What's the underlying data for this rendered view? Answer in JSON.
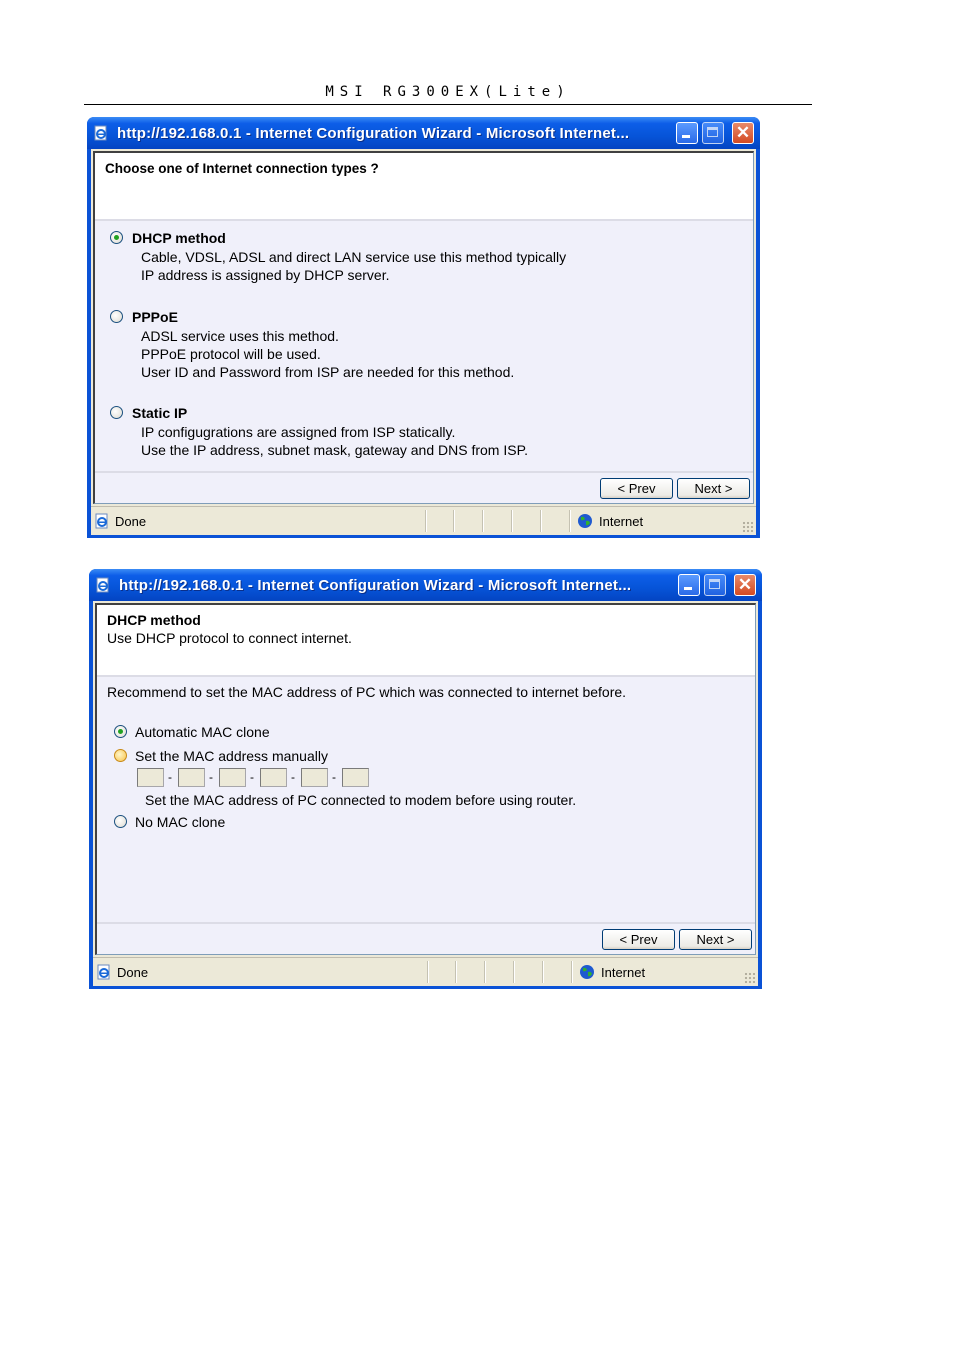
{
  "document": {
    "header": "MSI RG300EX(Lite)"
  },
  "window1": {
    "title": "http://192.168.0.1 - Internet Configuration Wizard - Microsoft Internet...",
    "heading": "Choose one of Internet connection types ?",
    "options": [
      {
        "label": "DHCP method",
        "checked": true,
        "lines": [
          "Cable, VDSL, ADSL and direct LAN service use this method typically",
          "IP address is assigned by DHCP server."
        ]
      },
      {
        "label": "PPPoE",
        "checked": false,
        "lines": [
          "ADSL service uses this method.",
          "PPPoE protocol will be used.",
          "User ID and Password from ISP are needed for this method."
        ]
      },
      {
        "label": "Static IP",
        "checked": false,
        "lines": [
          "IP configugrations are assigned from ISP statically.",
          "Use the IP address, subnet mask, gateway and DNS from ISP."
        ]
      }
    ],
    "prev_label": "< Prev",
    "next_label": "Next >",
    "status_text": "Done",
    "zone_text": "Internet"
  },
  "window2": {
    "title": "http://192.168.0.1 - Internet Configuration Wizard - Microsoft Internet...",
    "heading": "DHCP method",
    "subheading": "Use DHCP protocol to connect internet.",
    "recommend": "Recommend to set the MAC address of PC which was connected to internet before.",
    "options": [
      {
        "label": "Automatic MAC clone",
        "checked": true
      },
      {
        "label": "Set the MAC address manually",
        "checked": false,
        "hover": true
      },
      {
        "label": "No MAC clone",
        "checked": false
      }
    ],
    "mac_fields": [
      "",
      "",
      "",
      "",
      "",
      ""
    ],
    "mac_separator": "-",
    "mac_hint": "Set the MAC address of PC connected to modem before using router.",
    "prev_label": "< Prev",
    "next_label": "Next >",
    "status_text": "Done",
    "zone_text": "Internet"
  },
  "icons": {
    "title": "ie-page-icon",
    "status": "ie-page-icon",
    "zone": "globe-icon"
  }
}
